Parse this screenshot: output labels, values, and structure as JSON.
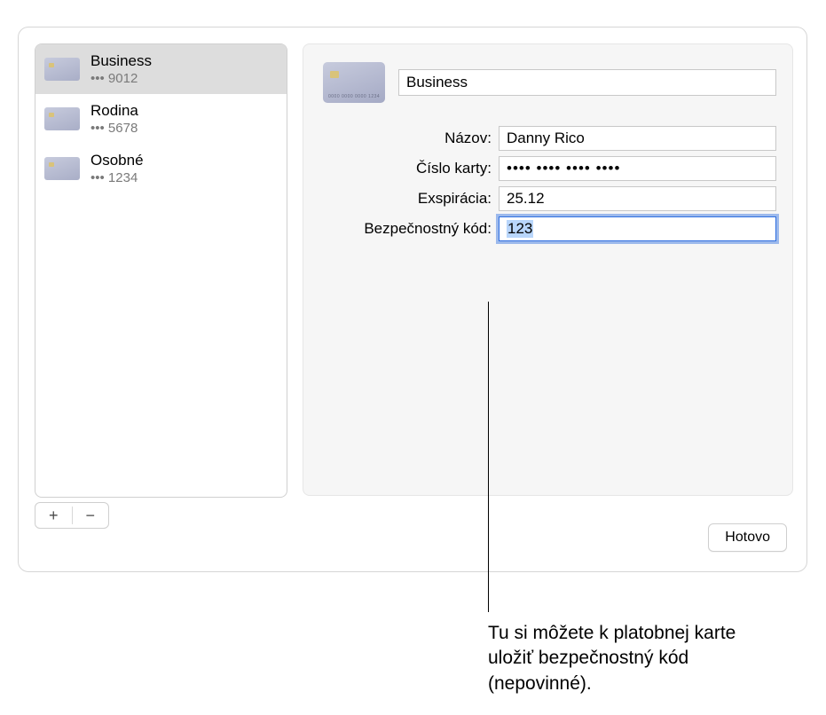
{
  "sidebar": {
    "items": [
      {
        "title": "Business",
        "sub": "••• 9012"
      },
      {
        "title": "Rodina",
        "sub": "••• 5678"
      },
      {
        "title": "Osobné",
        "sub": "••• 1234"
      }
    ]
  },
  "buttons": {
    "plus": "+",
    "minus": "−",
    "done": "Hotovo"
  },
  "form": {
    "description_value": "Business",
    "labels": {
      "name": "Názov:",
      "number": "Číslo karty:",
      "expiry": "Exspirácia:",
      "cvv": "Bezpečnostný kód:"
    },
    "name_value": "Danny Rico",
    "number_value": "•••• •••• •••• ••••",
    "expiry_value": "25.12",
    "cvv_value": "123"
  },
  "callout": "Tu si môžete k platobnej karte uložiť bezpečnostný kód (nepovinné)."
}
